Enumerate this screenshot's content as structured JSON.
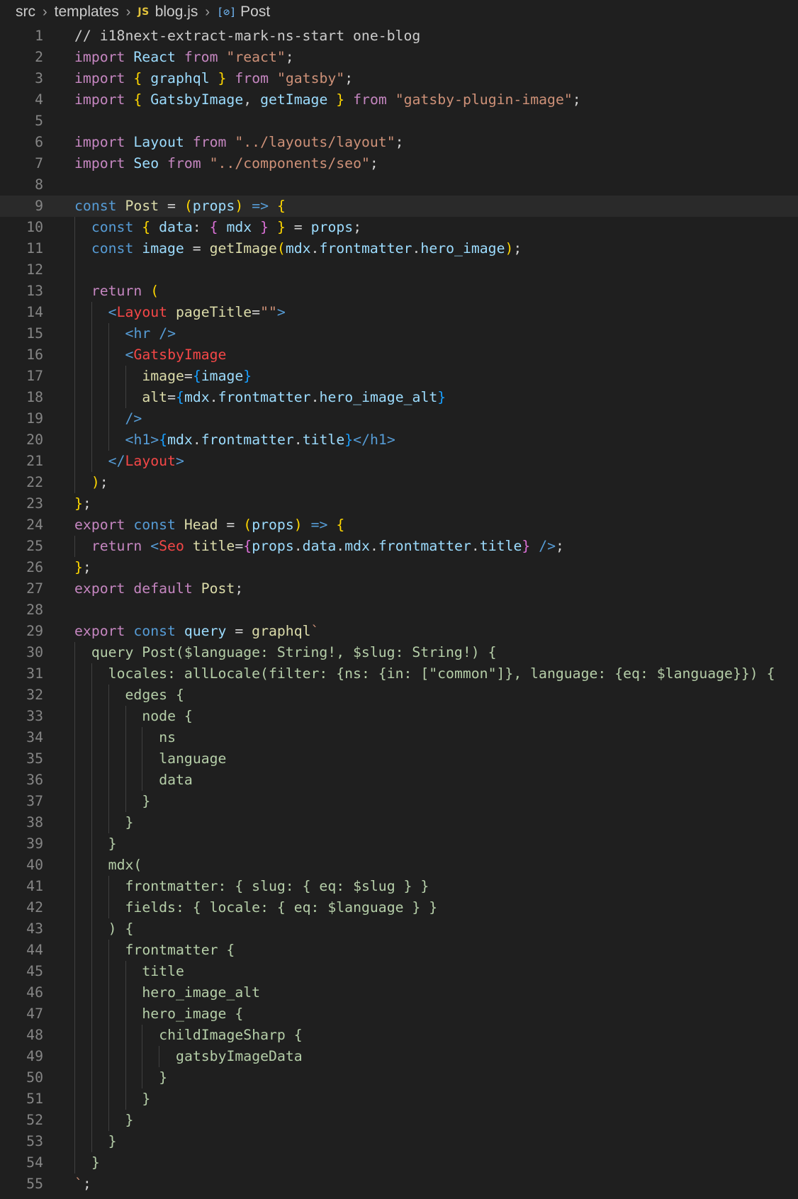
{
  "breadcrumb": {
    "items": [
      "src",
      "templates",
      "blog.js",
      "Post"
    ],
    "file_icon": "JS",
    "symbol_icon": "symbol-variable-icon"
  },
  "colors": {
    "background": "#1f1f1f",
    "line_number": "#858585",
    "keyword": "#c586c0",
    "string": "#ce9178"
  },
  "editor": {
    "current_line": 9,
    "lines": [
      {
        "n": "1",
        "indent": 0,
        "t": [
          [
            "// i18next-extract-mark-ns-start one-blog",
            "cm"
          ]
        ]
      },
      {
        "n": "2",
        "indent": 0,
        "t": [
          [
            "import",
            "kw"
          ],
          [
            " ",
            ""
          ],
          [
            "React",
            "var"
          ],
          [
            " ",
            ""
          ],
          [
            "from",
            "kw"
          ],
          [
            " ",
            ""
          ],
          [
            "\"react\"",
            "str"
          ],
          [
            ";",
            "op"
          ]
        ]
      },
      {
        "n": "3",
        "indent": 0,
        "t": [
          [
            "import",
            "kw"
          ],
          [
            " ",
            ""
          ],
          [
            "{",
            "p1"
          ],
          [
            " ",
            ""
          ],
          [
            "graphql",
            "var"
          ],
          [
            " ",
            ""
          ],
          [
            "}",
            "p1"
          ],
          [
            " ",
            ""
          ],
          [
            "from",
            "kw"
          ],
          [
            " ",
            ""
          ],
          [
            "\"gatsby\"",
            "str"
          ],
          [
            ";",
            "op"
          ]
        ]
      },
      {
        "n": "4",
        "indent": 0,
        "t": [
          [
            "import",
            "kw"
          ],
          [
            " ",
            ""
          ],
          [
            "{",
            "p1"
          ],
          [
            " ",
            ""
          ],
          [
            "GatsbyImage",
            "var"
          ],
          [
            ", ",
            ""
          ],
          [
            "getImage",
            "var"
          ],
          [
            " ",
            ""
          ],
          [
            "}",
            "p1"
          ],
          [
            " ",
            ""
          ],
          [
            "from",
            "kw"
          ],
          [
            " ",
            ""
          ],
          [
            "\"gatsby-plugin-image\"",
            "str"
          ],
          [
            ";",
            "op"
          ]
        ]
      },
      {
        "n": "5",
        "indent": 0,
        "t": []
      },
      {
        "n": "6",
        "indent": 0,
        "t": [
          [
            "import",
            "kw"
          ],
          [
            " ",
            ""
          ],
          [
            "Layout",
            "var"
          ],
          [
            " ",
            ""
          ],
          [
            "from",
            "kw"
          ],
          [
            " ",
            ""
          ],
          [
            "\"../layouts/layout\"",
            "str"
          ],
          [
            ";",
            "op"
          ]
        ]
      },
      {
        "n": "7",
        "indent": 0,
        "t": [
          [
            "import",
            "kw"
          ],
          [
            " ",
            ""
          ],
          [
            "Seo",
            "var"
          ],
          [
            " ",
            ""
          ],
          [
            "from",
            "kw"
          ],
          [
            " ",
            ""
          ],
          [
            "\"../components/seo\"",
            "str"
          ],
          [
            ";",
            "op"
          ]
        ]
      },
      {
        "n": "8",
        "indent": 0,
        "t": []
      },
      {
        "n": "9",
        "indent": 0,
        "t": [
          [
            "const",
            "kb"
          ],
          [
            " ",
            ""
          ],
          [
            "Post",
            "fn"
          ],
          [
            " ",
            ""
          ],
          [
            "=",
            "op"
          ],
          [
            " ",
            ""
          ],
          [
            "(",
            "p1"
          ],
          [
            "props",
            "var"
          ],
          [
            ")",
            "p1"
          ],
          [
            " ",
            ""
          ],
          [
            "=>",
            "kb"
          ],
          [
            " ",
            ""
          ],
          [
            "{",
            "p1"
          ]
        ]
      },
      {
        "n": "10",
        "indent": 1,
        "t": [
          [
            "const",
            "kb"
          ],
          [
            " ",
            ""
          ],
          [
            "{",
            "p1"
          ],
          [
            " ",
            ""
          ],
          [
            "data",
            "var"
          ],
          [
            ": ",
            ""
          ],
          [
            "{",
            "p2"
          ],
          [
            " ",
            ""
          ],
          [
            "mdx",
            "var"
          ],
          [
            " ",
            ""
          ],
          [
            "}",
            "p2"
          ],
          [
            " ",
            ""
          ],
          [
            "}",
            "p1"
          ],
          [
            " ",
            ""
          ],
          [
            "=",
            "op"
          ],
          [
            " ",
            ""
          ],
          [
            "props",
            "var"
          ],
          [
            ";",
            "op"
          ]
        ]
      },
      {
        "n": "11",
        "indent": 1,
        "t": [
          [
            "const",
            "kb"
          ],
          [
            " ",
            ""
          ],
          [
            "image",
            "var"
          ],
          [
            " ",
            ""
          ],
          [
            "=",
            "op"
          ],
          [
            " ",
            ""
          ],
          [
            "getImage",
            "fn"
          ],
          [
            "(",
            "p1"
          ],
          [
            "mdx",
            "var"
          ],
          [
            ".",
            ""
          ],
          [
            "frontmatter",
            "var"
          ],
          [
            ".",
            ""
          ],
          [
            "hero_image",
            "var"
          ],
          [
            ")",
            "p1"
          ],
          [
            ";",
            "op"
          ]
        ]
      },
      {
        "n": "12",
        "indent": 1,
        "t": []
      },
      {
        "n": "13",
        "indent": 1,
        "t": [
          [
            "return",
            "kw"
          ],
          [
            " ",
            ""
          ],
          [
            "(",
            "p1"
          ]
        ]
      },
      {
        "n": "14",
        "indent": 2,
        "t": [
          [
            "<",
            "tag"
          ],
          [
            "Layout",
            "tagn"
          ],
          [
            " ",
            ""
          ],
          [
            "pageTitle",
            "fn"
          ],
          [
            "=",
            "op"
          ],
          [
            "\"\"",
            "str"
          ],
          [
            ">",
            "tag"
          ]
        ]
      },
      {
        "n": "15",
        "indent": 3,
        "t": [
          [
            "<",
            "tag"
          ],
          [
            "hr",
            "tag"
          ],
          [
            " ",
            ""
          ],
          [
            "/>",
            "tag"
          ]
        ]
      },
      {
        "n": "16",
        "indent": 3,
        "t": [
          [
            "<",
            "tag"
          ],
          [
            "GatsbyImage",
            "tagn"
          ]
        ]
      },
      {
        "n": "17",
        "indent": 4,
        "t": [
          [
            "image",
            "fn"
          ],
          [
            "=",
            "op"
          ],
          [
            "{",
            "p3"
          ],
          [
            "image",
            "var"
          ],
          [
            "}",
            "p3"
          ]
        ]
      },
      {
        "n": "18",
        "indent": 4,
        "t": [
          [
            "alt",
            "fn"
          ],
          [
            "=",
            "op"
          ],
          [
            "{",
            "p3"
          ],
          [
            "mdx",
            "var"
          ],
          [
            ".",
            ""
          ],
          [
            "frontmatter",
            "var"
          ],
          [
            ".",
            ""
          ],
          [
            "hero_image_alt",
            "var"
          ],
          [
            "}",
            "p3"
          ]
        ]
      },
      {
        "n": "19",
        "indent": 3,
        "t": [
          [
            "/>",
            "tag"
          ]
        ]
      },
      {
        "n": "20",
        "indent": 3,
        "t": [
          [
            "<",
            "tag"
          ],
          [
            "h1",
            "tag"
          ],
          [
            ">",
            "tag"
          ],
          [
            "{",
            "p3"
          ],
          [
            "mdx",
            "var"
          ],
          [
            ".",
            ""
          ],
          [
            "frontmatter",
            "var"
          ],
          [
            ".",
            ""
          ],
          [
            "title",
            "var"
          ],
          [
            "}",
            "p3"
          ],
          [
            "</",
            "tag"
          ],
          [
            "h1",
            "tag"
          ],
          [
            ">",
            "tag"
          ]
        ]
      },
      {
        "n": "21",
        "indent": 2,
        "t": [
          [
            "</",
            "tag"
          ],
          [
            "Layout",
            "tagn"
          ],
          [
            ">",
            "tag"
          ]
        ]
      },
      {
        "n": "22",
        "indent": 1,
        "t": [
          [
            ")",
            "p1"
          ],
          [
            ";",
            "op"
          ]
        ]
      },
      {
        "n": "23",
        "indent": 0,
        "t": [
          [
            "}",
            "p1"
          ],
          [
            ";",
            "op"
          ]
        ]
      },
      {
        "n": "24",
        "indent": 0,
        "t": [
          [
            "export",
            "kw"
          ],
          [
            " ",
            ""
          ],
          [
            "const",
            "kb"
          ],
          [
            " ",
            ""
          ],
          [
            "Head",
            "fn"
          ],
          [
            " ",
            ""
          ],
          [
            "=",
            "op"
          ],
          [
            " ",
            ""
          ],
          [
            "(",
            "p1"
          ],
          [
            "props",
            "var"
          ],
          [
            ")",
            "p1"
          ],
          [
            " ",
            ""
          ],
          [
            "=>",
            "kb"
          ],
          [
            " ",
            ""
          ],
          [
            "{",
            "p1"
          ]
        ]
      },
      {
        "n": "25",
        "indent": 1,
        "t": [
          [
            "return",
            "kw"
          ],
          [
            " ",
            ""
          ],
          [
            "<",
            "tag"
          ],
          [
            "Seo",
            "tagn"
          ],
          [
            " ",
            ""
          ],
          [
            "title",
            "fn"
          ],
          [
            "=",
            "op"
          ],
          [
            "{",
            "p2"
          ],
          [
            "props",
            "var"
          ],
          [
            ".",
            ""
          ],
          [
            "data",
            "var"
          ],
          [
            ".",
            ""
          ],
          [
            "mdx",
            "var"
          ],
          [
            ".",
            ""
          ],
          [
            "frontmatter",
            "var"
          ],
          [
            ".",
            ""
          ],
          [
            "title",
            "var"
          ],
          [
            "}",
            "p2"
          ],
          [
            " ",
            ""
          ],
          [
            "/>",
            "tag"
          ],
          [
            ";",
            "op"
          ]
        ]
      },
      {
        "n": "26",
        "indent": 0,
        "t": [
          [
            "}",
            "p1"
          ],
          [
            ";",
            "op"
          ]
        ]
      },
      {
        "n": "27",
        "indent": 0,
        "t": [
          [
            "export",
            "kw"
          ],
          [
            " ",
            ""
          ],
          [
            "default",
            "kw"
          ],
          [
            " ",
            ""
          ],
          [
            "Post",
            "fn"
          ],
          [
            ";",
            "op"
          ]
        ]
      },
      {
        "n": "28",
        "indent": 0,
        "t": []
      },
      {
        "n": "29",
        "indent": 0,
        "t": [
          [
            "export",
            "kw"
          ],
          [
            " ",
            ""
          ],
          [
            "const",
            "kb"
          ],
          [
            " ",
            ""
          ],
          [
            "query",
            "var"
          ],
          [
            " ",
            ""
          ],
          [
            "=",
            "op"
          ],
          [
            " ",
            ""
          ],
          [
            "graphql",
            "fn"
          ],
          [
            "`",
            "str"
          ]
        ]
      },
      {
        "n": "30",
        "indent": 1,
        "t": [
          [
            "query Post($language: String!, $slug: String!) {",
            "gql"
          ]
        ]
      },
      {
        "n": "31",
        "indent": 2,
        "t": [
          [
            "locales: allLocale(filter: {ns: {in: [\"common\"]}, language: {eq: $language}}) {",
            "gql"
          ]
        ]
      },
      {
        "n": "32",
        "indent": 3,
        "t": [
          [
            "edges {",
            "gql"
          ]
        ]
      },
      {
        "n": "33",
        "indent": 4,
        "t": [
          [
            "node {",
            "gql"
          ]
        ]
      },
      {
        "n": "34",
        "indent": 5,
        "t": [
          [
            "ns",
            "gql"
          ]
        ]
      },
      {
        "n": "35",
        "indent": 5,
        "t": [
          [
            "language",
            "gql"
          ]
        ]
      },
      {
        "n": "36",
        "indent": 5,
        "t": [
          [
            "data",
            "gql"
          ]
        ]
      },
      {
        "n": "37",
        "indent": 4,
        "t": [
          [
            "}",
            "gql"
          ]
        ]
      },
      {
        "n": "38",
        "indent": 3,
        "t": [
          [
            "}",
            "gql"
          ]
        ]
      },
      {
        "n": "39",
        "indent": 2,
        "t": [
          [
            "}",
            "gql"
          ]
        ]
      },
      {
        "n": "40",
        "indent": 2,
        "t": [
          [
            "mdx(",
            "gql"
          ]
        ]
      },
      {
        "n": "41",
        "indent": 3,
        "t": [
          [
            "frontmatter: { slug: { eq: $slug } }",
            "gql"
          ]
        ]
      },
      {
        "n": "42",
        "indent": 3,
        "t": [
          [
            "fields: { locale: { eq: $language } }",
            "gql"
          ]
        ]
      },
      {
        "n": "43",
        "indent": 2,
        "t": [
          [
            ") {",
            "gql"
          ]
        ]
      },
      {
        "n": "44",
        "indent": 3,
        "t": [
          [
            "frontmatter {",
            "gql"
          ]
        ]
      },
      {
        "n": "45",
        "indent": 4,
        "t": [
          [
            "title",
            "gql"
          ]
        ]
      },
      {
        "n": "46",
        "indent": 4,
        "t": [
          [
            "hero_image_alt",
            "gql"
          ]
        ]
      },
      {
        "n": "47",
        "indent": 4,
        "t": [
          [
            "hero_image {",
            "gql"
          ]
        ]
      },
      {
        "n": "48",
        "indent": 5,
        "t": [
          [
            "childImageSharp {",
            "gql"
          ]
        ]
      },
      {
        "n": "49",
        "indent": 6,
        "t": [
          [
            "gatsbyImageData",
            "gql"
          ]
        ]
      },
      {
        "n": "50",
        "indent": 5,
        "t": [
          [
            "}",
            "gql"
          ]
        ]
      },
      {
        "n": "51",
        "indent": 4,
        "t": [
          [
            "}",
            "gql"
          ]
        ]
      },
      {
        "n": "52",
        "indent": 3,
        "t": [
          [
            "}",
            "gql"
          ]
        ]
      },
      {
        "n": "53",
        "indent": 2,
        "t": [
          [
            "}",
            "gql"
          ]
        ]
      },
      {
        "n": "54",
        "indent": 1,
        "t": [
          [
            "}",
            "gql"
          ]
        ]
      },
      {
        "n": "55",
        "indent": 0,
        "t": [
          [
            "`",
            "str"
          ],
          [
            ";",
            "op"
          ]
        ]
      }
    ]
  }
}
